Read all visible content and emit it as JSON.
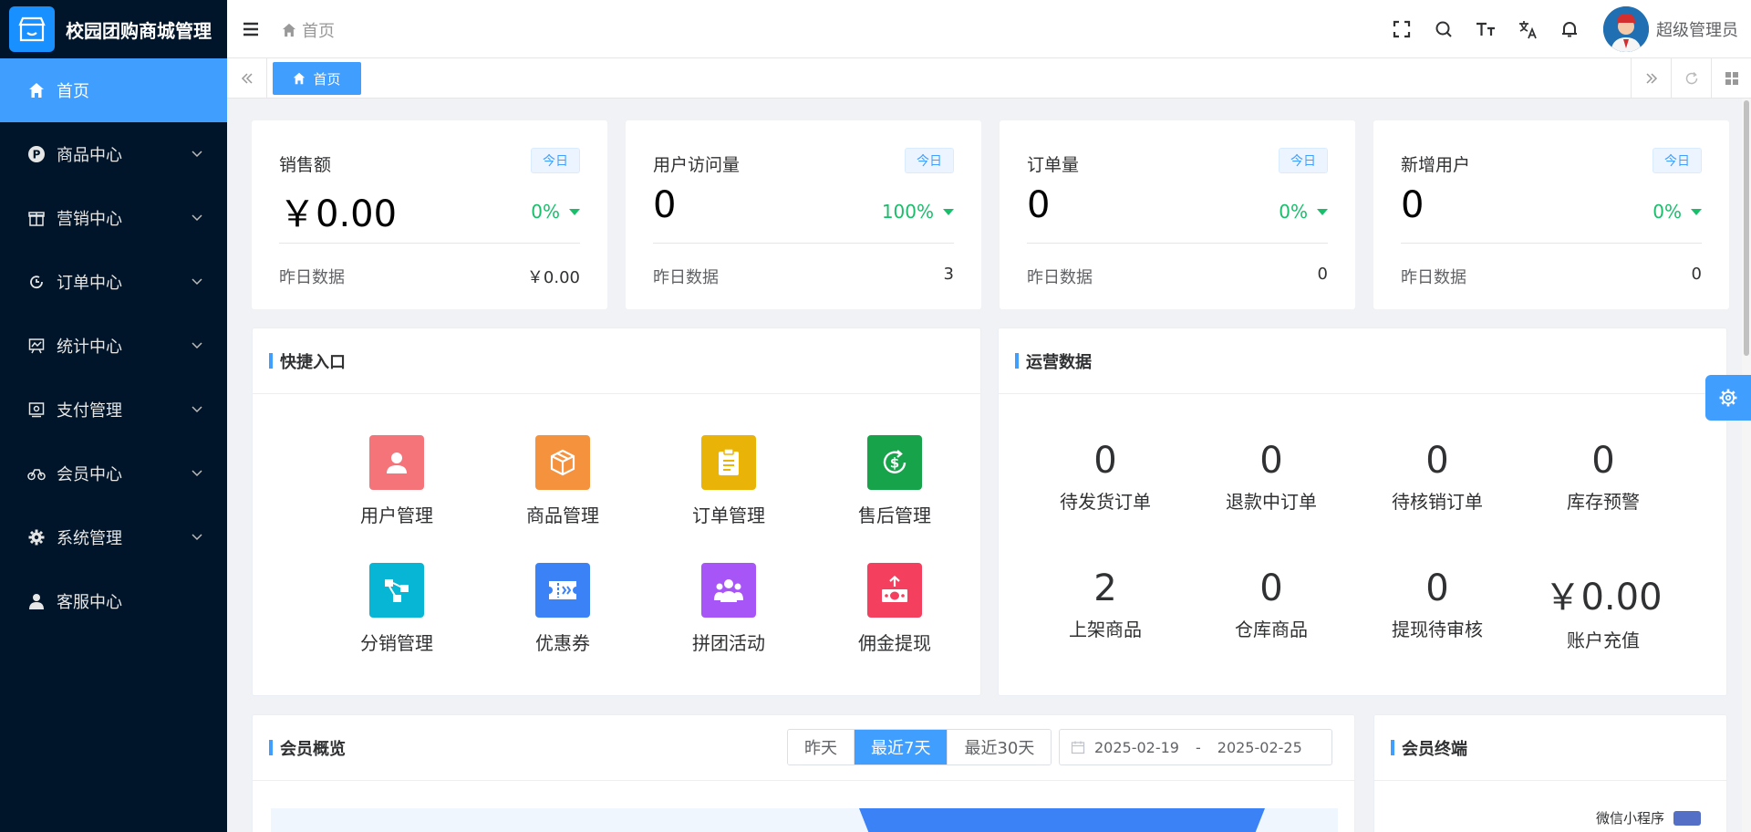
{
  "app": {
    "title": "校园团购商城管理"
  },
  "sidebar": {
    "items": [
      {
        "label": "首页",
        "icon": "home-icon",
        "active": true
      },
      {
        "label": "商品中心",
        "icon": "product-icon"
      },
      {
        "label": "营销中心",
        "icon": "marketing-icon"
      },
      {
        "label": "订单中心",
        "icon": "order-icon"
      },
      {
        "label": "统计中心",
        "icon": "stats-icon"
      },
      {
        "label": "支付管理",
        "icon": "payment-icon"
      },
      {
        "label": "会员中心",
        "icon": "member-icon"
      },
      {
        "label": "系统管理",
        "icon": "gear-icon"
      },
      {
        "label": "客服中心",
        "icon": "user-icon"
      }
    ]
  },
  "header": {
    "breadcrumb": "首页",
    "username": "超级管理员"
  },
  "tabs": {
    "active": "首页"
  },
  "stats": [
    {
      "label": "销售额",
      "badge": "今日",
      "value": "￥0.00",
      "pct": "0%",
      "foot_label": "昨日数据",
      "foot_value": "￥0.00"
    },
    {
      "label": "用户访问量",
      "badge": "今日",
      "value": "0",
      "pct": "100%",
      "foot_label": "昨日数据",
      "foot_value": "3"
    },
    {
      "label": "订单量",
      "badge": "今日",
      "value": "0",
      "pct": "0%",
      "foot_label": "昨日数据",
      "foot_value": "0"
    },
    {
      "label": "新增用户",
      "badge": "今日",
      "value": "0",
      "pct": "0%",
      "foot_label": "昨日数据",
      "foot_value": "0"
    }
  ],
  "quick": {
    "title": "快捷入口",
    "items": [
      {
        "label": "用户管理",
        "color": "#f4747a"
      },
      {
        "label": "商品管理",
        "color": "#f5923e"
      },
      {
        "label": "订单管理",
        "color": "#eab308"
      },
      {
        "label": "售后管理",
        "color": "#16a34a"
      },
      {
        "label": "分销管理",
        "color": "#06b6d4"
      },
      {
        "label": "优惠券",
        "color": "#3b82f6"
      },
      {
        "label": "拼团活动",
        "color": "#a855f7"
      },
      {
        "label": "佣金提现",
        "color": "#f43f5e"
      }
    ]
  },
  "ops": {
    "title": "运营数据",
    "items": [
      {
        "value": "0",
        "label": "待发货订单"
      },
      {
        "value": "0",
        "label": "退款中订单"
      },
      {
        "value": "0",
        "label": "待核销订单"
      },
      {
        "value": "0",
        "label": "库存预警"
      },
      {
        "value": "2",
        "label": "上架商品"
      },
      {
        "value": "0",
        "label": "仓库商品"
      },
      {
        "value": "0",
        "label": "提现待审核"
      },
      {
        "value": "￥0.00",
        "label": "账户充值"
      }
    ]
  },
  "member": {
    "title": "会员概览",
    "ranges": [
      "昨天",
      "最近7天",
      "最近30天"
    ],
    "active_range": "最近7天",
    "date_start": "2025-02-19",
    "date_sep": "-",
    "date_end": "2025-02-25"
  },
  "terminal": {
    "title": "会员终端",
    "legend": "微信小程序",
    "legend_color": "#5470c6"
  },
  "colors": {
    "accent": "#409eff",
    "sidebar_bg": "#001529",
    "up": "#19be6b"
  }
}
